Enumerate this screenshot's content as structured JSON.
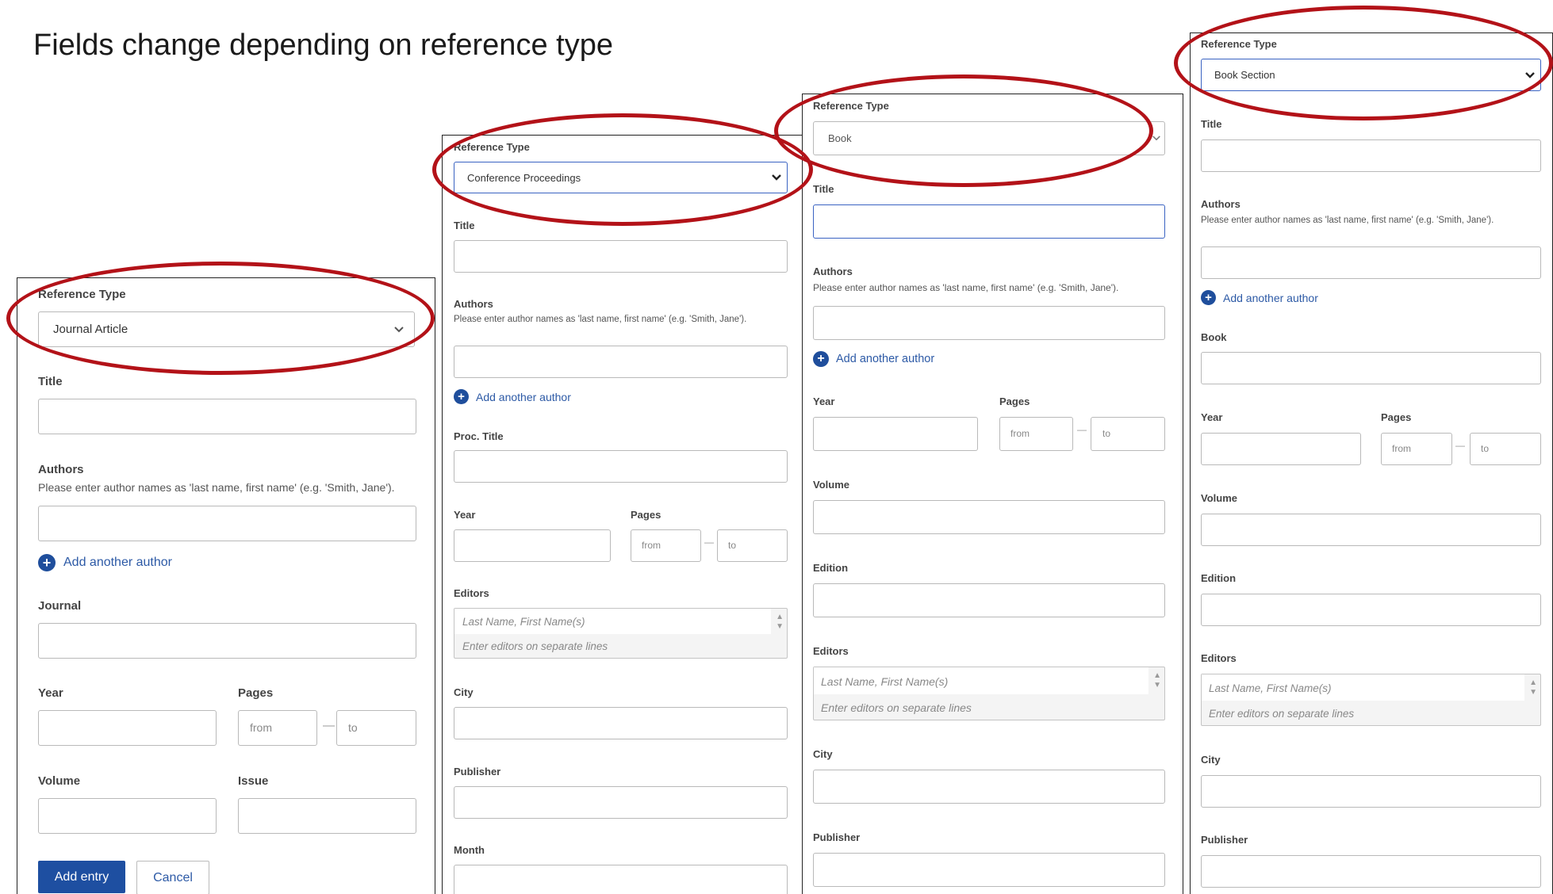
{
  "heading": "Fields change depending on reference type",
  "accent_color": "#b31218",
  "link_color": "#2d5aa6",
  "primary_button_color": "#1e4fa1",
  "common": {
    "reference_type_label": "Reference Type",
    "title_label": "Title",
    "authors_label": "Authors",
    "authors_hint": "Please enter author names as 'last name, first name' (e.g. 'Smith, Jane').",
    "add_author": "Add another author",
    "year_label": "Year",
    "pages_label": "Pages",
    "pages_from": "from",
    "pages_to": "to",
    "volume_label": "Volume",
    "issue_label": "Issue",
    "journal_label": "Journal",
    "proc_title_label": "Proc. Title",
    "book_label": "Book",
    "edition_label": "Edition",
    "editors_label": "Editors",
    "editors_placeholder_1": "Last Name, First Name(s)",
    "editors_placeholder_2": "Enter editors on separate lines",
    "city_label": "City",
    "publisher_label": "Publisher",
    "month_label": "Month",
    "add_entry_button": "Add entry",
    "cancel_button": "Cancel"
  },
  "panels": {
    "journal": {
      "reference_type": "Journal Article"
    },
    "conference": {
      "reference_type": "Conference Proceedings"
    },
    "book": {
      "reference_type": "Book"
    },
    "book_section": {
      "reference_type": "Book Section"
    }
  }
}
